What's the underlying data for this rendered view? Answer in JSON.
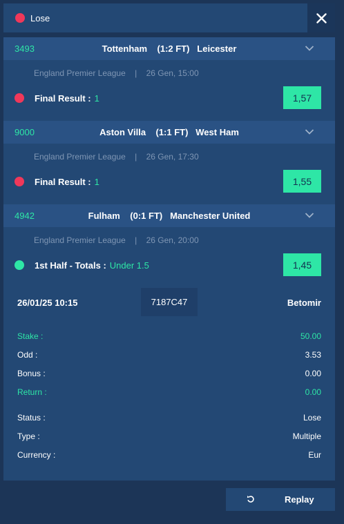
{
  "header": {
    "status_label": "Lose",
    "status_color": "#f0385a"
  },
  "events": [
    {
      "code": "3493",
      "match": "Tottenham    (1:2 FT)   Leicester",
      "league": "England Premier League",
      "date": "26 Gen, 15:00",
      "market": "Final Result :",
      "pick": "1",
      "odd": "1,57",
      "status_color": "#f0385a"
    },
    {
      "code": "9000",
      "match": "Aston Villa    (1:1 FT)   West Ham",
      "league": "England Premier League",
      "date": "26 Gen, 17:30",
      "market": "Final Result :",
      "pick": "1",
      "odd": "1,55",
      "status_color": "#f0385a"
    },
    {
      "code": "4942",
      "match": "Fulham    (0:1 FT)   Manchester United",
      "league": "England Premier League",
      "date": "26 Gen, 20:00",
      "market": "1st Half - Totals :",
      "pick": "Under 1.5",
      "odd": "1,45",
      "status_color": "#2ee6a6"
    }
  ],
  "summary": {
    "datetime": "26/01/25 10:15",
    "ticket_id": "7187C47",
    "brand": "Betomir",
    "stake_label": "Stake :",
    "stake": "50.00",
    "odd_label": "Odd :",
    "odd": "3.53",
    "bonus_label": "Bonus :",
    "bonus": "0.00",
    "return_label": "Return :",
    "return": "0.00",
    "status_label": "Status :",
    "status": "Lose",
    "type_label": "Type :",
    "type": "Multiple",
    "currency_label": "Currency :",
    "currency": "Eur"
  },
  "actions": {
    "replay_label": "Replay"
  },
  "colors": {
    "accent": "#2ee6a6",
    "lose": "#f0385a",
    "background": "#1c3557",
    "panel": "#234874"
  }
}
